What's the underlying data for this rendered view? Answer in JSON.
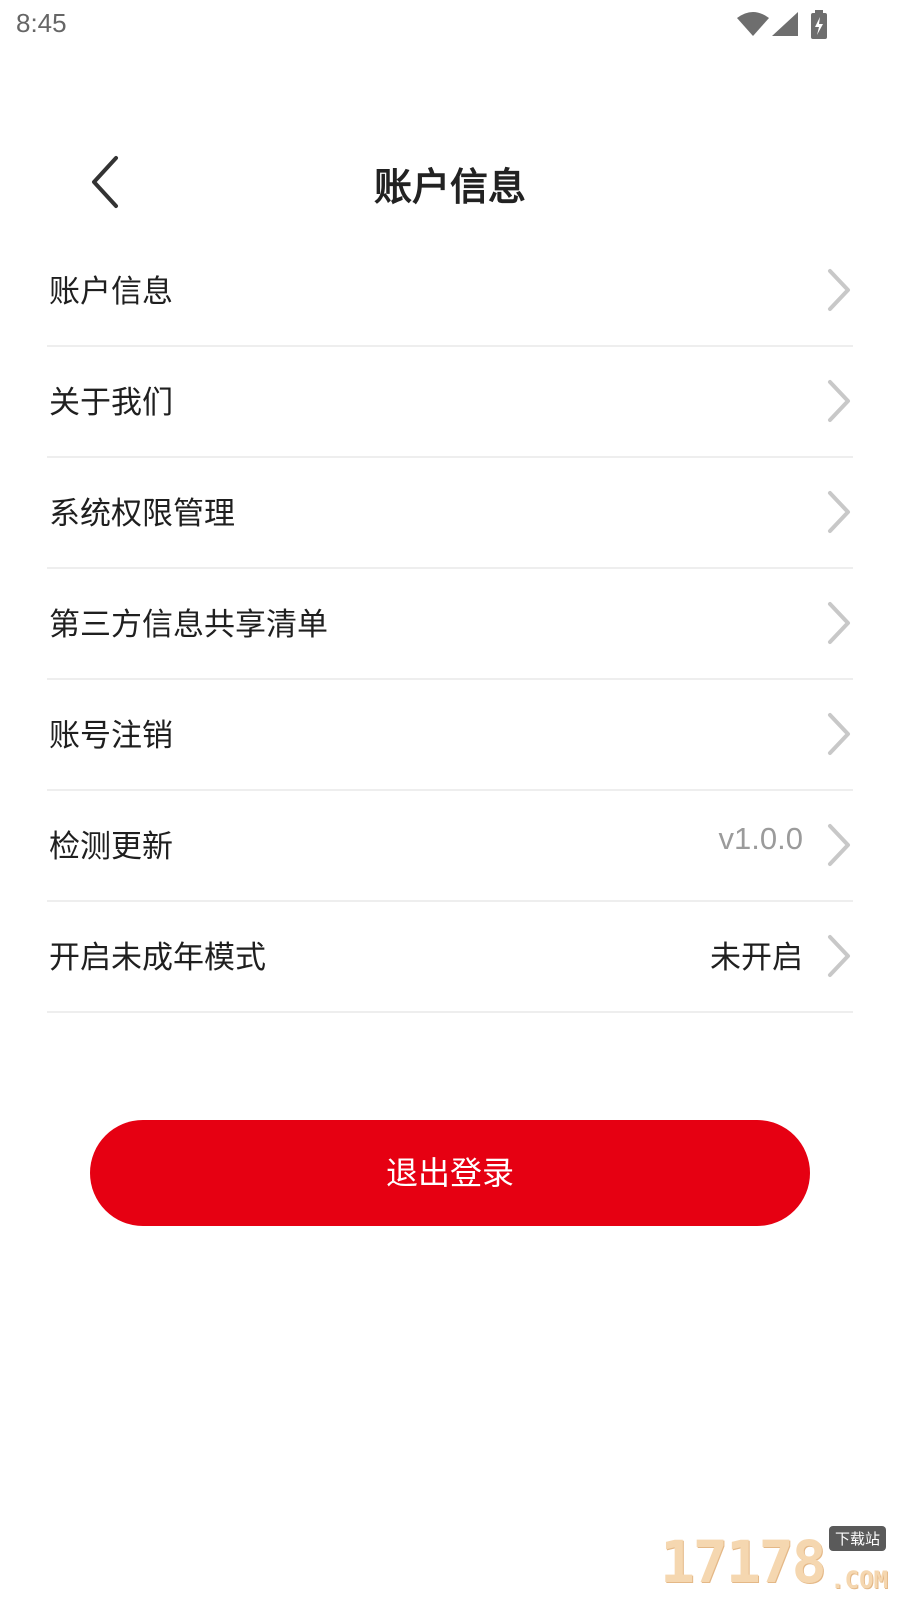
{
  "status_bar": {
    "time": "8:45",
    "icons": [
      "wifi-icon",
      "signal-icon",
      "battery-charging-icon"
    ]
  },
  "header": {
    "title": "账户信息",
    "back_icon": "chevron-left-icon"
  },
  "menu": {
    "items": [
      {
        "label": "账户信息",
        "value": ""
      },
      {
        "label": "关于我们",
        "value": ""
      },
      {
        "label": "系统权限管理",
        "value": ""
      },
      {
        "label": "第三方信息共享清单",
        "value": ""
      },
      {
        "label": "账号注销",
        "value": ""
      },
      {
        "label": "检测更新",
        "value": "v1.0.0"
      },
      {
        "label": "开启未成年模式",
        "value": "未开启"
      }
    ]
  },
  "logout": {
    "label": "退出登录"
  },
  "watermark": {
    "digits": "17178",
    "tag": "下载站",
    "domain": ".COM"
  },
  "colors": {
    "accent": "#e60012",
    "divider": "#eeeeee",
    "chevron": "#c8c8c8",
    "muted_text": "#9b9b9b"
  }
}
